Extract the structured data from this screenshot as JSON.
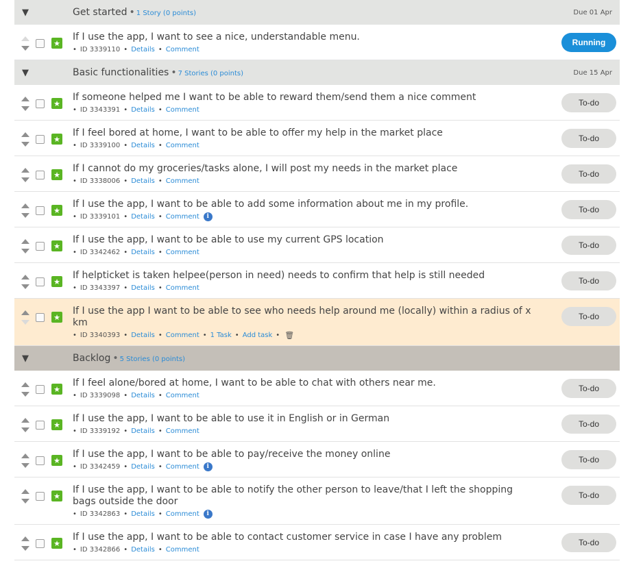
{
  "sections": [
    {
      "title": "Get started",
      "count": "1 Story (0 points)",
      "due": "Due 01 Apr",
      "stories": [
        {
          "text": "If I use the app, I want to see a nice, understandable menu.",
          "id": "ID 3339110",
          "status": "Running"
        }
      ]
    },
    {
      "title": "Basic functionalities",
      "count": "7 Stories (0 points)",
      "due": "Due 15 Apr",
      "stories": [
        {
          "text": "If someone helped me I want to be able to reward them/send them a nice comment",
          "id": "ID 3343391",
          "status": "To-do"
        },
        {
          "text": "If I feel bored at home, I want to be able to offer my help in the market place",
          "id": "ID 3339100",
          "status": "To-do"
        },
        {
          "text": "If I cannot do my groceries/tasks alone, I will post my needs in the market place",
          "id": "ID 3338006",
          "status": "To-do"
        },
        {
          "text": "If I use the app, I want to be able to add some information about me in my profile.",
          "id": "ID 3339101",
          "status": "To-do",
          "info": true
        },
        {
          "text": "If I use the app, I want to be able to use my current GPS location",
          "id": "ID 3342462",
          "status": "To-do"
        },
        {
          "text": "If helpticket is taken helpee(person in need) needs to confirm that help is still needed",
          "id": "ID 3343397",
          "status": "To-do"
        },
        {
          "text": "If I use the app I want to be able to see who needs help around me (locally) within a radius of x km",
          "id": "ID 3340393",
          "status": "To-do",
          "task_link": "1 Task",
          "add_task": "Add task",
          "trash": true,
          "highlight": true
        }
      ]
    },
    {
      "title": "Backlog",
      "count": "5 Stories (0 points)",
      "due": "",
      "stories": [
        {
          "text": "If I feel alone/bored at home, I want to be able to chat with others near me.",
          "id": "ID 3339098",
          "status": "To-do"
        },
        {
          "text": "If I use the app, I want to be able to use it in English or in German",
          "id": "ID 3339192",
          "status": "To-do"
        },
        {
          "text": "If I use the app, I want to be able to pay/receive the money online",
          "id": "ID 3342459",
          "status": "To-do",
          "info": true
        },
        {
          "text": "If I use the app, I want to be able to notify the other person to leave/that I left the shopping bags outside the door",
          "id": "ID 3342863",
          "status": "To-do",
          "info": true
        },
        {
          "text": "If I use the app, I want to be able to contact customer service in case I have any problem",
          "id": "ID 3342866",
          "status": "To-do"
        }
      ]
    }
  ],
  "labels": {
    "details": "Details",
    "comment": "Comment",
    "bullet": "•"
  },
  "icons": {
    "collapse": "triangle-down-icon",
    "star": "star-icon",
    "info": "info-icon",
    "trash": "trash-icon",
    "move_up": "move-up-arrow-icon",
    "move_down": "move-down-arrow-icon"
  },
  "colors": {
    "header_bg": "#e3e4e2",
    "backlog_header_bg": "#c4bfb8",
    "highlight_row": "#feebd0",
    "running": "#1a8fd9",
    "todo": "#dfdfdd",
    "link": "#2a8bd6",
    "star": "#5ab523"
  }
}
